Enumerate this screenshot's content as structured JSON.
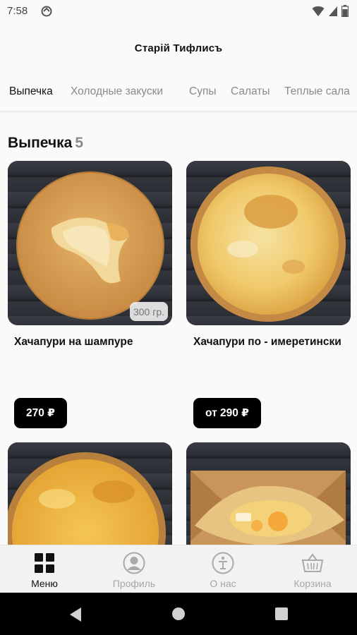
{
  "status_bar": {
    "time": "7:58"
  },
  "header": {
    "title": "Старій Тифлисъ"
  },
  "tabs": [
    {
      "label": "Выпечка",
      "active": true
    },
    {
      "label": "Холодные закуски",
      "active": false
    },
    {
      "label": "Супы",
      "active": false
    },
    {
      "label": "Салаты",
      "active": false
    },
    {
      "label": "Теплые сала",
      "active": false
    }
  ],
  "section": {
    "title": "Выпечка",
    "count": "5"
  },
  "products": [
    {
      "name": "Хачапури на шампуре",
      "weight": "300 гр.",
      "price": "270 ₽"
    },
    {
      "name": "Хачапури по - имеретински",
      "weight": "",
      "price": "от 290 ₽"
    },
    {
      "name": "",
      "weight": "",
      "price": ""
    },
    {
      "name": "",
      "weight": "",
      "price": ""
    }
  ],
  "bottom_nav": [
    {
      "label": "Меню",
      "icon": "grid-icon",
      "active": true
    },
    {
      "label": "Профиль",
      "icon": "profile-icon",
      "active": false
    },
    {
      "label": "О нас",
      "icon": "about-icon",
      "active": false
    },
    {
      "label": "Корзина",
      "icon": "basket-icon",
      "active": false
    }
  ],
  "colors": {
    "accent": "#000000",
    "inactive": "#8a8a8a",
    "nav_bg": "#f2f2f2"
  }
}
